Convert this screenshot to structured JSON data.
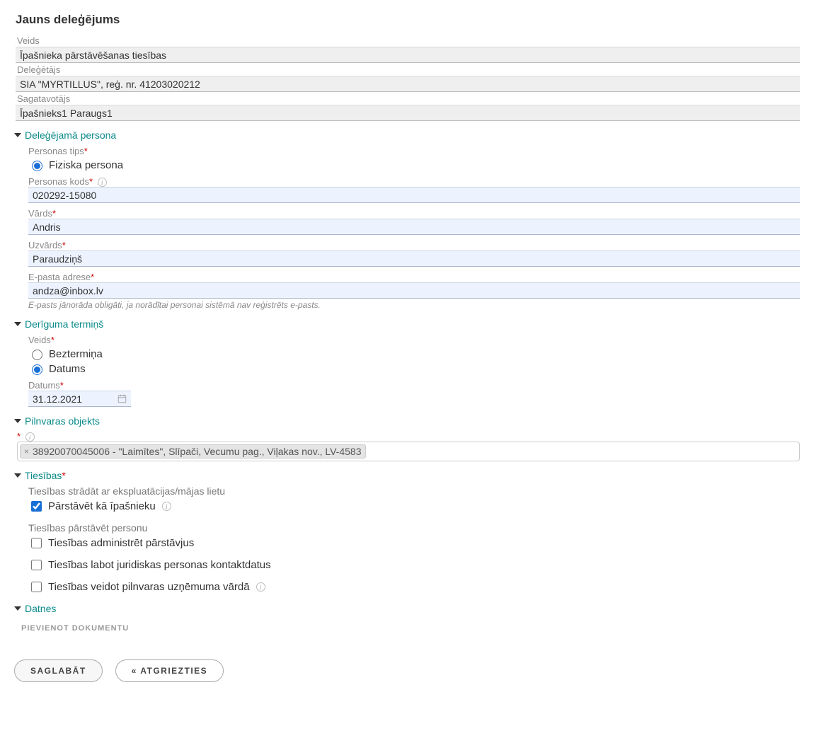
{
  "page": {
    "title": "Jauns deleģējums"
  },
  "readonly": {
    "type_label": "Veids",
    "type_value": "Īpašnieka pārstāvēšanas tiesības",
    "delegator_label": "Deleģētājs",
    "delegator_value": "SIA \"MYRTILLUS\", reģ. nr. 41203020212",
    "preparer_label": "Sagatavotājs",
    "preparer_value": "Īpašnieks1 Paraugs1"
  },
  "person_section": {
    "title": "Deleģējamā persona",
    "type_label": "Personas tips",
    "type_option": "Fiziska persona",
    "code_label": "Personas kods",
    "code_value": "020292-15080",
    "fname_label": "Vārds",
    "fname_value": "Andris",
    "lname_label": "Uzvārds",
    "lname_value": "Paraudziņš",
    "email_label": "E-pasta adrese",
    "email_value": "andza@inbox.lv",
    "email_hint": "E-pasts jānorāda obligāti, ja norādītai personai sistēmā nav reģistrēts e-pasts."
  },
  "validity_section": {
    "title": "Derīguma termiņš",
    "type_label": "Veids",
    "opt_unlimited": "Beztermiņa",
    "opt_date": "Datums",
    "date_label": "Datums",
    "date_value": "31.12.2021"
  },
  "object_section": {
    "title": "Pilnvaras objekts",
    "tag_text": "38920070045006 - \"Laimītes\", Slīpači, Vecumu pag., Viļakas nov., LV-4583"
  },
  "rights_section": {
    "title": "Tiesības",
    "sub1": "Tiesības strādāt ar ekspluatācijas/mājas lietu",
    "chk_owner": "Pārstāvēt kā īpašnieku",
    "sub2": "Tiesības pārstāvēt personu",
    "chk_admin": "Tiesības administrēt pārstāvjus",
    "chk_edit": "Tiesības labot juridiskas personas kontaktdatus",
    "chk_create": "Tiesības veidot pilnvaras uzņēmuma vārdā"
  },
  "files_section": {
    "title": "Datnes",
    "add_btn": "Pievienot dokumentu"
  },
  "footer": {
    "save": "Saglabāt",
    "back": "« Atgriezties"
  }
}
